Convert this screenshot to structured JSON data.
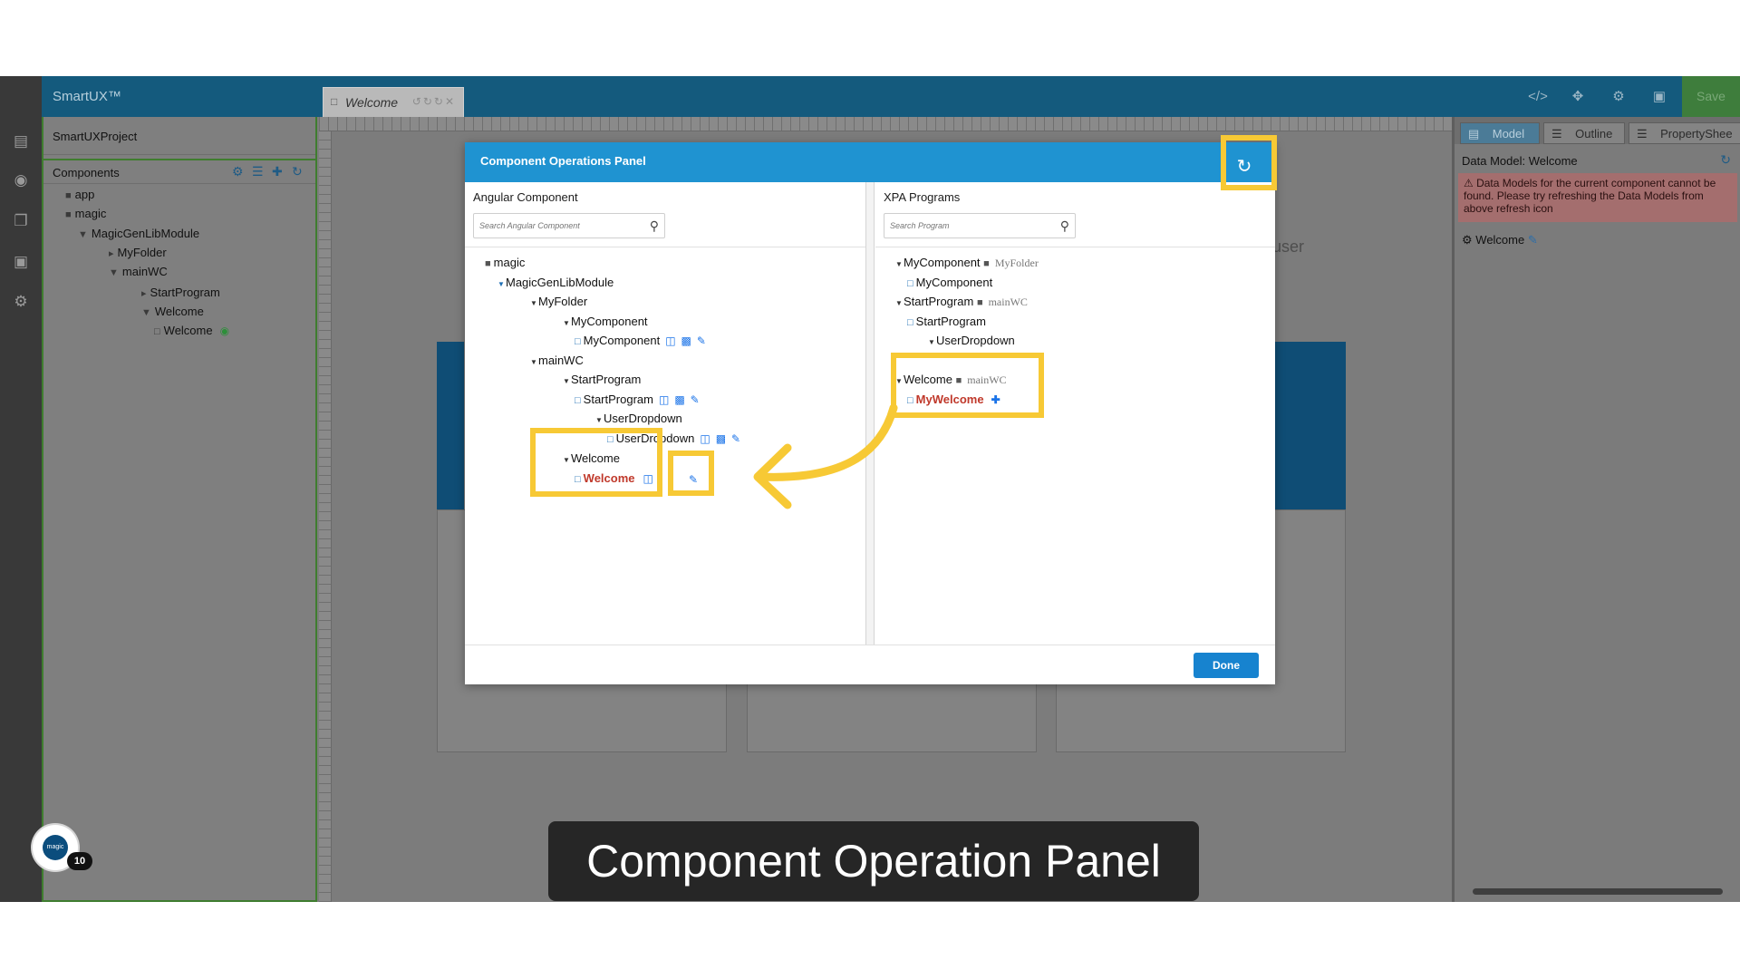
{
  "app": {
    "brand": "SmartUX™",
    "tab_label": "Welcome",
    "save_label": "Save",
    "accent_color": "#1f93d1",
    "highlight_color": "#f7c935"
  },
  "sidebar": {
    "project": "SmartUXProject",
    "components_title": "Components",
    "tree": {
      "app": "app",
      "magic": "magic",
      "module": "MagicGenLibModule",
      "myfolder": "MyFolder",
      "mainwc": "mainWC",
      "startprogram": "StartProgram",
      "welcome_folder": "Welcome",
      "welcome_item": "Welcome"
    }
  },
  "canvas": {
    "partial_text": "user"
  },
  "right_panel": {
    "tabs": [
      "Model",
      "Outline",
      "PropertyShee"
    ],
    "title": "Data Model: Welcome",
    "warning": "Data Models for the current component cannot be found. Please try refreshing the Data Models from above refresh icon",
    "item": "Welcome"
  },
  "modal": {
    "title": "Component Operations Panel",
    "left": {
      "title": "Angular Component",
      "search_placeholder": "Search Angular Component",
      "tree": {
        "magic": "magic",
        "module": "MagicGenLibModule",
        "myfolder": "MyFolder",
        "mycomponent_folder": "MyComponent",
        "mycomponent_item": "MyComponent",
        "mainwc": "mainWC",
        "startprogram_folder": "StartProgram",
        "startprogram_item": "StartProgram",
        "userdropdown_folder": "UserDropdown",
        "userdropdown_item": "UserDropdown",
        "welcome_folder": "Welcome",
        "welcome_item": "Welcome"
      }
    },
    "right": {
      "title": "XPA Programs",
      "search_placeholder": "Search Program",
      "tree": {
        "mycomponent_folder": "MyComponent",
        "mycomponent_loc": "MyFolder",
        "mycomponent_item": "MyComponent",
        "startprogram_folder": "StartProgram",
        "startprogram_loc": "mainWC",
        "startprogram_item": "StartProgram",
        "userdropdown_folder": "UserDropdown",
        "welcome_folder": "Welcome",
        "welcome_loc": "mainWC",
        "mywelcome_item": "MyWelcome"
      }
    },
    "done_label": "Done"
  },
  "help": {
    "logo_text": "magic",
    "badge": "10"
  },
  "caption": "Component Operation Panel"
}
